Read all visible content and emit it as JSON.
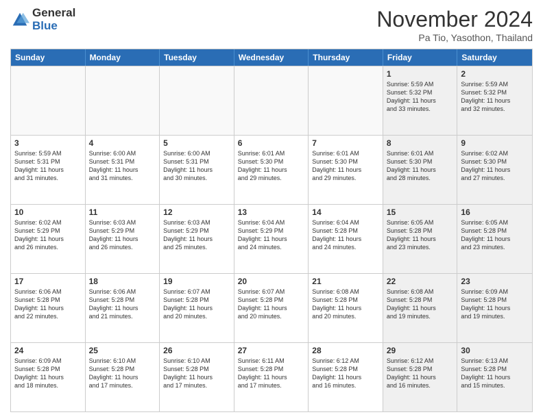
{
  "header": {
    "logo_line1": "General",
    "logo_line2": "Blue",
    "month": "November 2024",
    "location": "Pa Tio, Yasothon, Thailand"
  },
  "weekdays": [
    "Sunday",
    "Monday",
    "Tuesday",
    "Wednesday",
    "Thursday",
    "Friday",
    "Saturday"
  ],
  "rows": [
    [
      {
        "day": "",
        "text": "",
        "empty": true
      },
      {
        "day": "",
        "text": "",
        "empty": true
      },
      {
        "day": "",
        "text": "",
        "empty": true
      },
      {
        "day": "",
        "text": "",
        "empty": true
      },
      {
        "day": "",
        "text": "",
        "empty": true
      },
      {
        "day": "1",
        "text": "Sunrise: 5:59 AM\nSunset: 5:32 PM\nDaylight: 11 hours\nand 33 minutes.",
        "empty": false,
        "shaded": true
      },
      {
        "day": "2",
        "text": "Sunrise: 5:59 AM\nSunset: 5:32 PM\nDaylight: 11 hours\nand 32 minutes.",
        "empty": false,
        "shaded": true
      }
    ],
    [
      {
        "day": "3",
        "text": "Sunrise: 5:59 AM\nSunset: 5:31 PM\nDaylight: 11 hours\nand 31 minutes.",
        "empty": false
      },
      {
        "day": "4",
        "text": "Sunrise: 6:00 AM\nSunset: 5:31 PM\nDaylight: 11 hours\nand 31 minutes.",
        "empty": false
      },
      {
        "day": "5",
        "text": "Sunrise: 6:00 AM\nSunset: 5:31 PM\nDaylight: 11 hours\nand 30 minutes.",
        "empty": false
      },
      {
        "day": "6",
        "text": "Sunrise: 6:01 AM\nSunset: 5:30 PM\nDaylight: 11 hours\nand 29 minutes.",
        "empty": false
      },
      {
        "day": "7",
        "text": "Sunrise: 6:01 AM\nSunset: 5:30 PM\nDaylight: 11 hours\nand 29 minutes.",
        "empty": false
      },
      {
        "day": "8",
        "text": "Sunrise: 6:01 AM\nSunset: 5:30 PM\nDaylight: 11 hours\nand 28 minutes.",
        "empty": false,
        "shaded": true
      },
      {
        "day": "9",
        "text": "Sunrise: 6:02 AM\nSunset: 5:30 PM\nDaylight: 11 hours\nand 27 minutes.",
        "empty": false,
        "shaded": true
      }
    ],
    [
      {
        "day": "10",
        "text": "Sunrise: 6:02 AM\nSunset: 5:29 PM\nDaylight: 11 hours\nand 26 minutes.",
        "empty": false
      },
      {
        "day": "11",
        "text": "Sunrise: 6:03 AM\nSunset: 5:29 PM\nDaylight: 11 hours\nand 26 minutes.",
        "empty": false
      },
      {
        "day": "12",
        "text": "Sunrise: 6:03 AM\nSunset: 5:29 PM\nDaylight: 11 hours\nand 25 minutes.",
        "empty": false
      },
      {
        "day": "13",
        "text": "Sunrise: 6:04 AM\nSunset: 5:29 PM\nDaylight: 11 hours\nand 24 minutes.",
        "empty": false
      },
      {
        "day": "14",
        "text": "Sunrise: 6:04 AM\nSunset: 5:28 PM\nDaylight: 11 hours\nand 24 minutes.",
        "empty": false
      },
      {
        "day": "15",
        "text": "Sunrise: 6:05 AM\nSunset: 5:28 PM\nDaylight: 11 hours\nand 23 minutes.",
        "empty": false,
        "shaded": true
      },
      {
        "day": "16",
        "text": "Sunrise: 6:05 AM\nSunset: 5:28 PM\nDaylight: 11 hours\nand 23 minutes.",
        "empty": false,
        "shaded": true
      }
    ],
    [
      {
        "day": "17",
        "text": "Sunrise: 6:06 AM\nSunset: 5:28 PM\nDaylight: 11 hours\nand 22 minutes.",
        "empty": false
      },
      {
        "day": "18",
        "text": "Sunrise: 6:06 AM\nSunset: 5:28 PM\nDaylight: 11 hours\nand 21 minutes.",
        "empty": false
      },
      {
        "day": "19",
        "text": "Sunrise: 6:07 AM\nSunset: 5:28 PM\nDaylight: 11 hours\nand 20 minutes.",
        "empty": false
      },
      {
        "day": "20",
        "text": "Sunrise: 6:07 AM\nSunset: 5:28 PM\nDaylight: 11 hours\nand 20 minutes.",
        "empty": false
      },
      {
        "day": "21",
        "text": "Sunrise: 6:08 AM\nSunset: 5:28 PM\nDaylight: 11 hours\nand 20 minutes.",
        "empty": false
      },
      {
        "day": "22",
        "text": "Sunrise: 6:08 AM\nSunset: 5:28 PM\nDaylight: 11 hours\nand 19 minutes.",
        "empty": false,
        "shaded": true
      },
      {
        "day": "23",
        "text": "Sunrise: 6:09 AM\nSunset: 5:28 PM\nDaylight: 11 hours\nand 19 minutes.",
        "empty": false,
        "shaded": true
      }
    ],
    [
      {
        "day": "24",
        "text": "Sunrise: 6:09 AM\nSunset: 5:28 PM\nDaylight: 11 hours\nand 18 minutes.",
        "empty": false
      },
      {
        "day": "25",
        "text": "Sunrise: 6:10 AM\nSunset: 5:28 PM\nDaylight: 11 hours\nand 17 minutes.",
        "empty": false
      },
      {
        "day": "26",
        "text": "Sunrise: 6:10 AM\nSunset: 5:28 PM\nDaylight: 11 hours\nand 17 minutes.",
        "empty": false
      },
      {
        "day": "27",
        "text": "Sunrise: 6:11 AM\nSunset: 5:28 PM\nDaylight: 11 hours\nand 17 minutes.",
        "empty": false
      },
      {
        "day": "28",
        "text": "Sunrise: 6:12 AM\nSunset: 5:28 PM\nDaylight: 11 hours\nand 16 minutes.",
        "empty": false
      },
      {
        "day": "29",
        "text": "Sunrise: 6:12 AM\nSunset: 5:28 PM\nDaylight: 11 hours\nand 16 minutes.",
        "empty": false,
        "shaded": true
      },
      {
        "day": "30",
        "text": "Sunrise: 6:13 AM\nSunset: 5:28 PM\nDaylight: 11 hours\nand 15 minutes.",
        "empty": false,
        "shaded": true
      }
    ]
  ]
}
